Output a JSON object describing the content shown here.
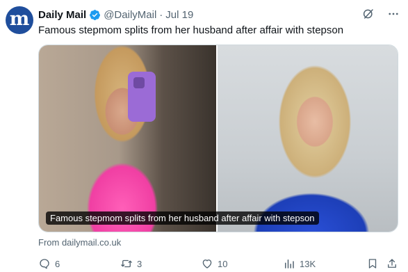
{
  "author": {
    "avatar_letter": "m",
    "name": "Daily Mail",
    "handle": "@DailyMail",
    "separator": "·",
    "date": "Jul 19"
  },
  "tweet": {
    "text": "Famous stepmom splits from her husband after affair with stepson"
  },
  "card": {
    "caption": "Famous stepmom splits from her husband after affair with stepson",
    "source": "From dailymail.co.uk"
  },
  "actions": {
    "replies": "6",
    "reposts": "3",
    "likes": "10",
    "views": "13K"
  },
  "icons": {
    "verified": "verified-badge-icon",
    "grok": "grok-icon",
    "more": "more-icon",
    "reply": "reply-icon",
    "repost": "repost-icon",
    "like": "heart-icon",
    "views": "views-icon",
    "bookmark": "bookmark-icon",
    "share": "share-icon"
  },
  "colors": {
    "brand_blue": "#1f4e9c",
    "verified_blue": "#1d9bf0",
    "text_primary": "#0f1419",
    "text_secondary": "#536471"
  }
}
